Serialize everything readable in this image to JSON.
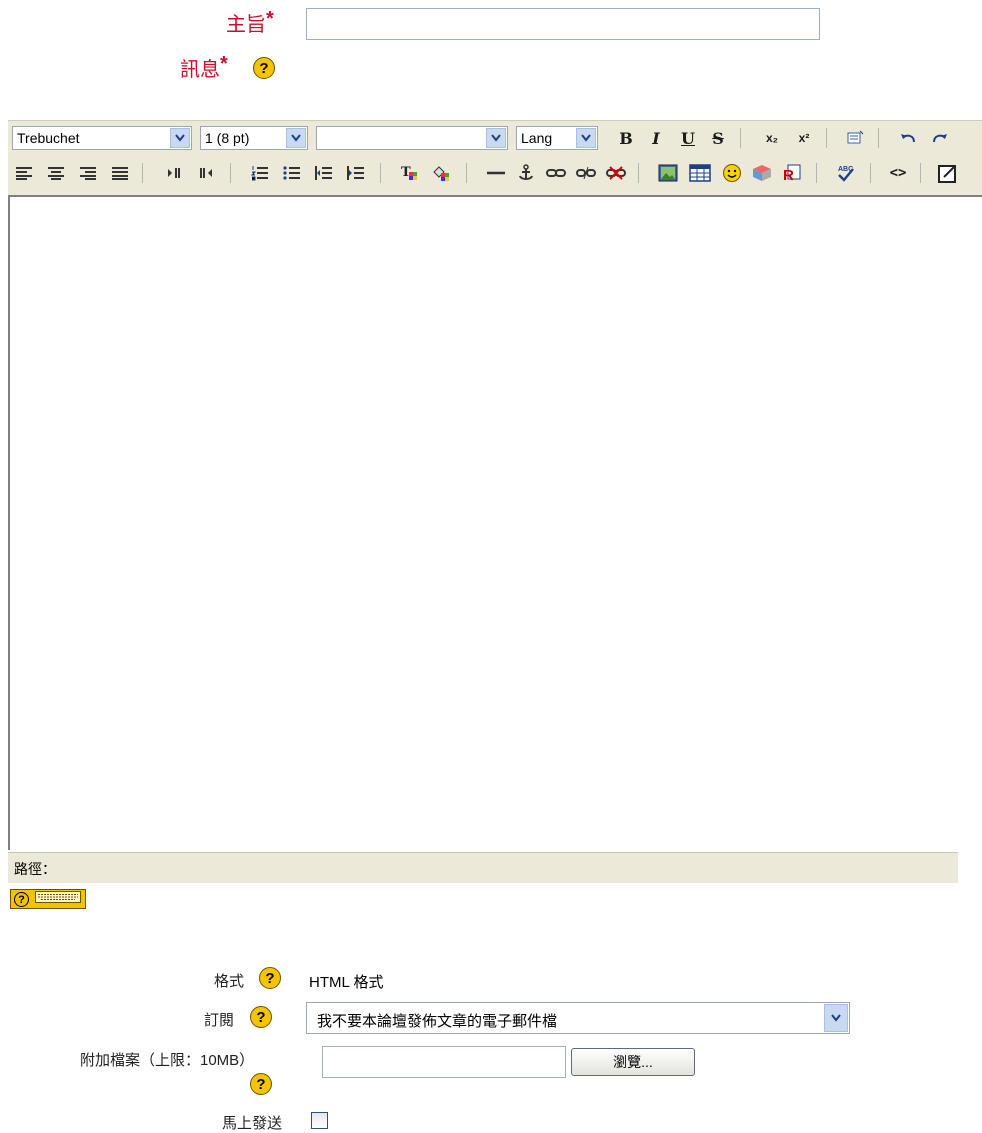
{
  "subject": {
    "label": "主旨",
    "required_mark": "*",
    "value": ""
  },
  "message": {
    "label": "訊息",
    "required_mark": "*"
  },
  "editor": {
    "font_select": "Trebuchet",
    "size_select": "1 (8 pt)",
    "style_select": "",
    "lang_select": "Lang",
    "buttons": {
      "bold": "B",
      "italic": "I",
      "underline": "U",
      "strike": "S",
      "subscript": "x₂",
      "superscript": "x²",
      "html_source": "<>"
    },
    "content": "",
    "path_label": "路徑：",
    "keyboard_help": "?"
  },
  "format": {
    "label": "格式",
    "value": "HTML 格式"
  },
  "subscription": {
    "label": "訂閱",
    "selected": "我不要本論壇發佈文章的電子郵件檔"
  },
  "attachment": {
    "label": "附加檔案（上限：10MB）",
    "browse_label": "瀏覽..."
  },
  "send_now": {
    "label": "馬上發送",
    "checked": false
  },
  "help_symbol": "?"
}
